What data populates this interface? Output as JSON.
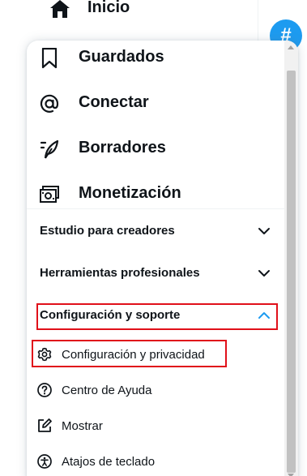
{
  "nav": {
    "top_item": {
      "label": "Inicio",
      "icon": "home-icon"
    }
  },
  "menu": {
    "items": [
      {
        "label": "Guardados",
        "icon": "bookmark-icon"
      },
      {
        "label": "Conectar",
        "icon": "at-icon"
      },
      {
        "label": "Borradores",
        "icon": "feather-icon"
      },
      {
        "label": "Monetización",
        "icon": "money-icon"
      }
    ],
    "sections": [
      {
        "label": "Estudio para creadores",
        "expanded": false
      },
      {
        "label": "Herramientas profesionales",
        "expanded": false
      },
      {
        "label": "Configuración y soporte",
        "expanded": true,
        "highlighted": true
      }
    ],
    "subitems": [
      {
        "label": "Configuración y privacidad",
        "icon": "gear-icon",
        "highlighted": true
      },
      {
        "label": "Centro de Ayuda",
        "icon": "help-circle-icon"
      },
      {
        "label": "Mostrar",
        "icon": "edit-icon"
      },
      {
        "label": "Atajos de teclado",
        "icon": "accessibility-icon"
      }
    ]
  },
  "colors": {
    "text": "#0f1419",
    "accent": "#1d9bf0",
    "highlight_border": "#e0101a",
    "separator": "#eff3f4"
  }
}
